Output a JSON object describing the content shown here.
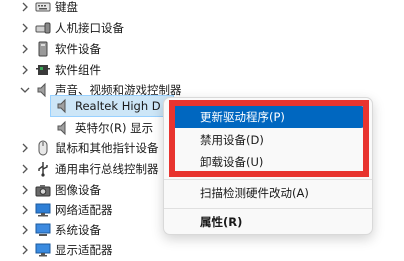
{
  "tree": {
    "items": [
      {
        "label": "键盘",
        "expanded": false,
        "icon": "keyboard-icon"
      },
      {
        "label": "人机接口设备",
        "expanded": false,
        "icon": "hid-icon"
      },
      {
        "label": "软件设备",
        "expanded": false,
        "icon": "software-device-icon"
      },
      {
        "label": "软件组件",
        "expanded": false,
        "icon": "software-component-icon"
      },
      {
        "label": "声音、视频和游戏控制器",
        "expanded": true,
        "icon": "speaker-icon"
      },
      {
        "label": "Realtek High D",
        "child": true,
        "selected": true,
        "icon": "speaker-icon"
      },
      {
        "label": "英特尔(R) 显示",
        "child": true,
        "icon": "speaker-icon"
      },
      {
        "label": "鼠标和其他指针设备",
        "expanded": false,
        "icon": "mouse-icon"
      },
      {
        "label": "通用串行总线控制器",
        "expanded": false,
        "icon": "usb-icon"
      },
      {
        "label": "图像设备",
        "expanded": false,
        "icon": "camera-icon"
      },
      {
        "label": "网络适配器",
        "expanded": false,
        "icon": "network-icon"
      },
      {
        "label": "系统设备",
        "expanded": false,
        "icon": "system-device-icon"
      },
      {
        "label": "显示适配器",
        "expanded": false,
        "icon": "monitor-icon"
      }
    ]
  },
  "context_menu": {
    "items": [
      {
        "label": "更新驱动程序(P)",
        "highlighted": true
      },
      {
        "label": "禁用设备(D)"
      },
      {
        "label": "卸载设备(U)"
      },
      {
        "label": "扫描检测硬件改动(A)"
      },
      {
        "label": "属性(R)",
        "bold": true
      }
    ]
  },
  "colors": {
    "menu_highlight": "#0067c0",
    "selection": "#cde6f7",
    "annotation_box": "#e8342f"
  }
}
